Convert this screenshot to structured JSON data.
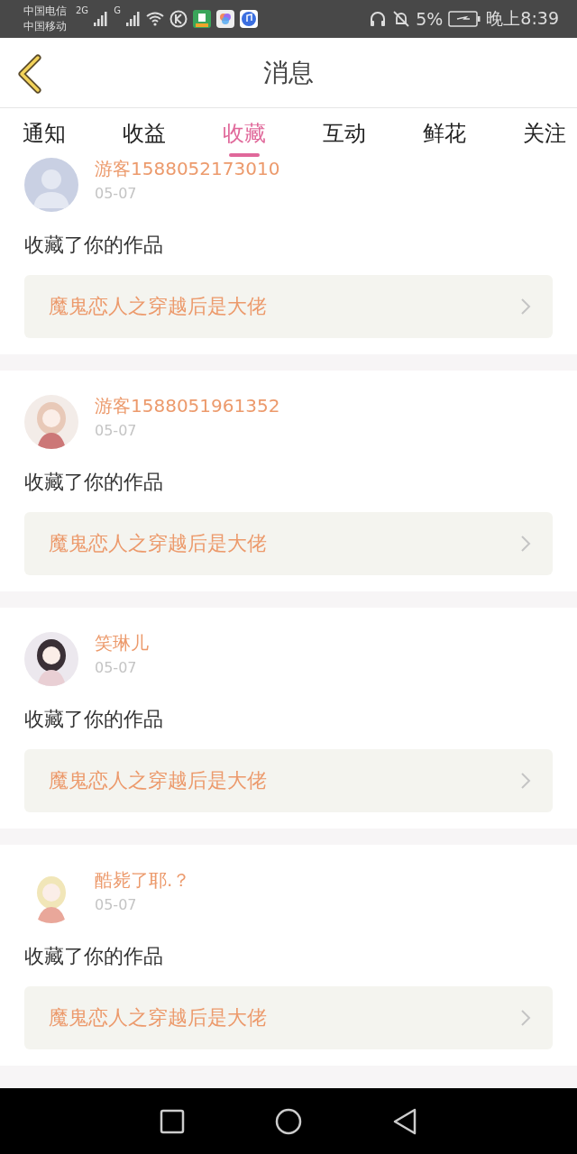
{
  "status_bar": {
    "carriers": [
      "中国电信",
      "中国移动"
    ],
    "network_1": "2G",
    "network_2": "G",
    "battery": "5%",
    "time": "晚上8:39"
  },
  "header": {
    "title": "消息"
  },
  "tabs": [
    {
      "label": "通知",
      "selected": false
    },
    {
      "label": "收益",
      "selected": false
    },
    {
      "label": "收藏",
      "selected": true
    },
    {
      "label": "互动",
      "selected": false
    },
    {
      "label": "鲜花",
      "selected": false
    },
    {
      "label": "关注",
      "selected": false
    }
  ],
  "messages": [
    {
      "kind": "default",
      "name": "游客1588052173010",
      "date": "05-07",
      "text": "收藏了你的作品",
      "work": "魔鬼恋人之穿越后是大佬"
    },
    {
      "kind": "picture",
      "name": "游客1588051961352",
      "date": "05-07",
      "text": "收藏了你的作品",
      "work": "魔鬼恋人之穿越后是大佬"
    },
    {
      "kind": "picture",
      "name": "笑琳儿",
      "date": "05-07",
      "text": "收藏了你的作品",
      "work": "魔鬼恋人之穿越后是大佬"
    },
    {
      "kind": "picture",
      "name": "酷毙了耶.？",
      "date": "05-07",
      "text": "收藏了你的作品",
      "work": "魔鬼恋人之穿越后是大佬"
    }
  ]
}
